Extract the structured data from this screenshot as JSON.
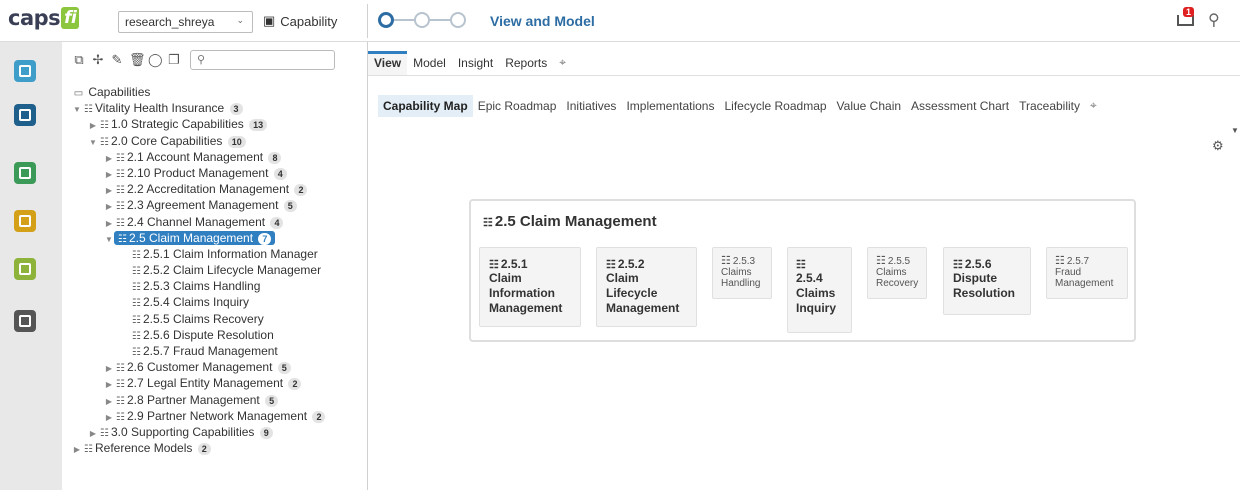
{
  "header": {
    "logo_text": "caps",
    "logo_fi": "fi",
    "repository": "research_shreya",
    "view_label": "Capability",
    "stepper_label": "View and Model",
    "notification_count": "1"
  },
  "colors": {
    "accent": "#2f7fc1",
    "brand_green": "#8cc63f",
    "notif_red": "#e02020"
  },
  "rail": {
    "items": [
      {
        "name": "rail-item-1",
        "color": "#3f9ec9"
      },
      {
        "name": "rail-item-2",
        "color": "#1f5f8b"
      },
      {
        "name": "rail-item-3",
        "color": "#3b9a57"
      },
      {
        "name": "rail-item-4",
        "color": "#d4a017"
      },
      {
        "name": "rail-item-5",
        "color": "#8db33a"
      },
      {
        "name": "rail-item-6",
        "color": "#555555"
      }
    ]
  },
  "tree": {
    "root": "Capabilities",
    "nodes": [
      {
        "label": "Vitality Health Insurance",
        "count": "3"
      },
      {
        "label": "1.0 Strategic Capabilities",
        "count": "13"
      },
      {
        "label": "2.0 Core Capabilities",
        "count": "10"
      },
      {
        "label": "2.1 Account Management",
        "count": "8"
      },
      {
        "label": "2.10 Product Management",
        "count": "4"
      },
      {
        "label": "2.2 Accreditation Management",
        "count": "2"
      },
      {
        "label": "2.3 Agreement Management",
        "count": "5"
      },
      {
        "label": "2.4 Channel Management",
        "count": "4"
      },
      {
        "label": "2.5 Claim Management",
        "count": "7"
      },
      {
        "label": "2.5.1 Claim Information Manager"
      },
      {
        "label": "2.5.2 Claim Lifecycle Managemer"
      },
      {
        "label": "2.5.3 Claims Handling"
      },
      {
        "label": "2.5.4 Claims Inquiry"
      },
      {
        "label": "2.5.5 Claims Recovery"
      },
      {
        "label": "2.5.6 Dispute Resolution"
      },
      {
        "label": "2.5.7 Fraud Management"
      },
      {
        "label": "2.6 Customer Management",
        "count": "5"
      },
      {
        "label": "2.7 Legal Entity Management",
        "count": "2"
      },
      {
        "label": "2.8 Partner Management",
        "count": "5"
      },
      {
        "label": "2.9 Partner Network Management",
        "count": "2"
      },
      {
        "label": "3.0 Supporting Capabilities",
        "count": "9"
      },
      {
        "label": "Reference Models",
        "count": "2"
      }
    ]
  },
  "main": {
    "tabs": [
      "View",
      "Model",
      "Insight",
      "Reports"
    ],
    "subtabs": [
      "Capability Map",
      "Epic Roadmap",
      "Initiatives",
      "Implementations",
      "Lifecycle Roadmap",
      "Value Chain",
      "Assessment Chart",
      "Traceability"
    ],
    "card": {
      "title": "2.5 Claim Management",
      "children": [
        {
          "num": "2.5.1",
          "name_lines": [
            "Claim",
            "Information",
            "Management"
          ]
        },
        {
          "num": "2.5.2",
          "name_lines": [
            "Claim",
            "Lifecycle",
            "Management"
          ]
        },
        {
          "num": "2.5.3",
          "name_lines": [
            "Claims",
            "Handling"
          ]
        },
        {
          "num": "",
          "name_lines": [
            "2.5.4",
            "Claims",
            "Inquiry"
          ]
        },
        {
          "num": "2.5.5",
          "name_lines": [
            "Claims",
            "Recovery"
          ]
        },
        {
          "num": "2.5.6",
          "name_lines": [
            "Dispute",
            "Resolution"
          ]
        },
        {
          "num": "2.5.7",
          "name_lines": [
            "Fraud",
            "Management"
          ]
        }
      ]
    }
  }
}
